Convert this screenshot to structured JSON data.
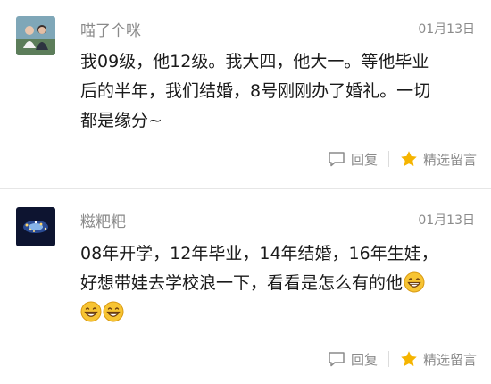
{
  "comments": [
    {
      "nickname": "喵了个咪",
      "date": "01月13日",
      "avatar_icon": "couple-photo-avatar",
      "lines": [
        "我09级，他12级。我大四，他大一。等他毕业",
        "后的半年，我们结婚，8号刚刚办了婚礼。一切",
        "都是缘分~"
      ],
      "reply_label": "回复",
      "featured_label": "精选留言"
    },
    {
      "nickname": "糍粑粑",
      "date": "01月13日",
      "avatar_icon": "night-lights-avatar",
      "lines": [
        "08年开学，12年毕业，14年结婚，16年生娃，",
        "好想带娃去学校浪一下，看看是怎么有的他"
      ],
      "emoji_icon": "grinning-face-emoji",
      "reply_label": "回复",
      "featured_label": "精选留言"
    }
  ],
  "colors": {
    "meta_text": "#8a8a8a",
    "body_text": "#1a1a1a",
    "star": "#f5b400",
    "divider": "#e6e6e6"
  }
}
